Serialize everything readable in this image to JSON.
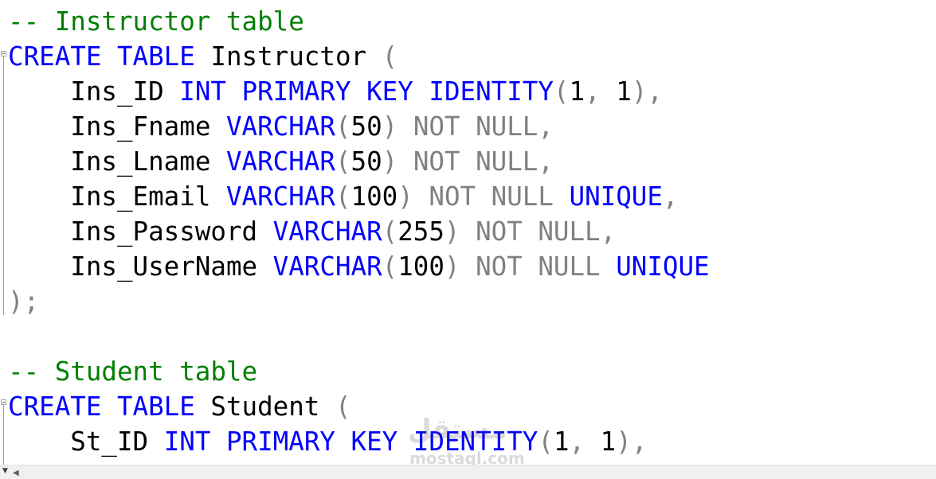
{
  "colors": {
    "keyword": "#0000ff",
    "operator": "#808080",
    "comment": "#008000",
    "identifier": "#000000"
  },
  "code": {
    "l1": {
      "comment": "-- Instructor table"
    },
    "l2": {
      "k1": "CREATE",
      "k2": "TABLE",
      "name": "Instructor",
      "paren": "("
    },
    "l3": {
      "col": "Ins_ID",
      "type": "INT",
      "pk1": "PRIMARY",
      "pk2": "KEY",
      "ident": "IDENTITY",
      "p_open": "(",
      "seed": "1",
      "comma": ",",
      "incr": "1",
      "p_close": "),",
      "indent": "    "
    },
    "l4": {
      "col": "Ins_Fname",
      "type": "VARCHAR",
      "p_open": "(",
      "len": "50",
      "p_close": ")",
      "nn": "NOT NULL,",
      "indent": "    "
    },
    "l5": {
      "col": "Ins_Lname",
      "type": "VARCHAR",
      "p_open": "(",
      "len": "50",
      "p_close": ")",
      "nn": "NOT NULL,",
      "indent": "    "
    },
    "l6": {
      "col": "Ins_Email",
      "type": "VARCHAR",
      "p_open": "(",
      "len": "100",
      "p_close": ")",
      "nn": "NOT NULL",
      "uq": "UNIQUE",
      "trail": ",",
      "indent": "    "
    },
    "l7": {
      "col": "Ins_Password",
      "type": "VARCHAR",
      "p_open": "(",
      "len": "255",
      "p_close": ")",
      "nn": "NOT NULL,",
      "indent": "    "
    },
    "l8": {
      "col": "Ins_UserName",
      "type": "VARCHAR",
      "p_open": "(",
      "len": "100",
      "p_close": ")",
      "nn": "NOT NULL",
      "uq": "UNIQUE",
      "indent": "    "
    },
    "l9": {
      "end": ");"
    },
    "l11": {
      "comment": "-- Student table"
    },
    "l12": {
      "k1": "CREATE",
      "k2": "TABLE",
      "name": "Student",
      "paren": "("
    },
    "l13": {
      "col": "St_ID",
      "type": "INT",
      "pk1": "PRIMARY",
      "pk2": "KEY",
      "ident": "IDENTITY",
      "p_open": "(",
      "seed": "1",
      "comma": ",",
      "incr": "1",
      "p_close": "),",
      "indent": "    "
    }
  },
  "watermark": {
    "mark": "مستقل",
    "domain": "mostaql.com"
  },
  "scrollbar": {
    "zoom_icon": "dropdown-arrow-icon",
    "scroll_left_icon": "scroll-left-icon"
  }
}
